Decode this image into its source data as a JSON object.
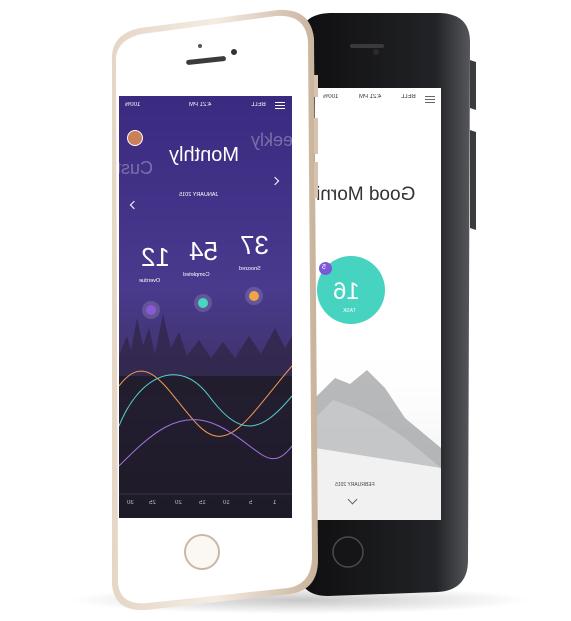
{
  "front_phone": {
    "status_bar": {
      "time": "4:21 PM",
      "carrier": "BELL",
      "battery": "100%"
    },
    "tabs": [
      "Custom",
      "Monthly",
      "Weekly"
    ],
    "active_tab": "Monthly",
    "period_label": "JANUARY 2015",
    "stats": [
      {
        "value": "37",
        "label": "Snoozed",
        "dot_color": "#f2a24a"
      },
      {
        "value": "54",
        "label": "Completed",
        "dot_color": "#48d6c1"
      },
      {
        "value": "12",
        "label": "Overdue",
        "dot_color": "#8a5ad6"
      }
    ],
    "x_axis_ticks": [
      "1",
      "5",
      "10",
      "15",
      "20",
      "25",
      "30"
    ],
    "colors": {
      "gradient_top": "#3b2b82",
      "gradient_bottom": "#1f1b2d",
      "line_orange": "#f39a54",
      "line_teal": "#59cfd0",
      "line_purple": "#a474df"
    }
  },
  "back_phone": {
    "status_bar": {
      "time": "4:21 PM",
      "carrier": "BELL",
      "battery": "100%"
    },
    "greeting": "Good Morning",
    "circle_value": "16",
    "circle_label": "TASK",
    "badge": "5",
    "date_label": "FEBRUARY 2015",
    "colors": {
      "accent": "#46d3bf",
      "badge": "#7a58d6"
    }
  }
}
